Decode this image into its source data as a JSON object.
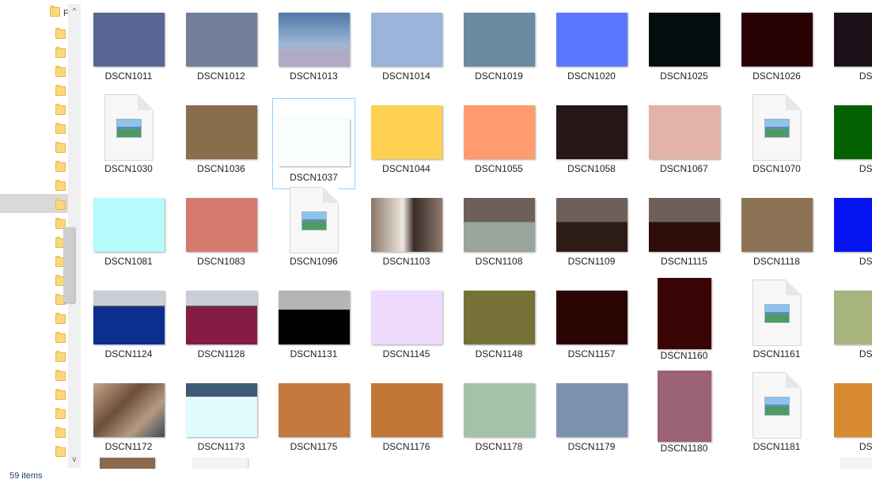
{
  "status": {
    "item_count": "59 items"
  },
  "nav": {
    "top_letter": "F"
  },
  "scrollbar": {
    "up_arrow": "^",
    "down_arrow": "v"
  },
  "tiles": [
    {
      "name": "DSCN1011",
      "color": "#5a6796"
    },
    {
      "name": "DSCN1012",
      "color": "#717f9d"
    },
    {
      "name": "DSCN1013",
      "color": "#b3a9c4",
      "photo": "sky"
    },
    {
      "name": "DSCN1014",
      "color": "#9cb3da"
    },
    {
      "name": "DSCN1019",
      "color": "#698aa1"
    },
    {
      "name": "DSCN1020",
      "color": "#5a78ff"
    },
    {
      "name": "DSCN1025",
      "color": "#020d10"
    },
    {
      "name": "DSCN1026",
      "color": "#290304"
    },
    {
      "name": "DSC",
      "color": "#1d1119",
      "partial": true
    },
    {
      "name": "DSCN1030",
      "icon": true
    },
    {
      "name": "DSCN1036",
      "color": "#8a6d4d"
    },
    {
      "name": "DSCN1037",
      "color": "#f8fdfd",
      "selected": true
    },
    {
      "name": "DSCN1044",
      "color": "#ffd152"
    },
    {
      "name": "DSCN1055",
      "color": "#ff9b6d"
    },
    {
      "name": "DSCN1058",
      "color": "#251716"
    },
    {
      "name": "DSCN1067",
      "color": "#e1b4a7"
    },
    {
      "name": "DSCN1070",
      "icon": true
    },
    {
      "name": "DSC",
      "color": "#036101",
      "partial": true
    },
    {
      "name": "DSCN1081",
      "color": "#b6fcfd"
    },
    {
      "name": "DSCN1083",
      "color": "#d77a6e"
    },
    {
      "name": "DSCN1096",
      "icon": true
    },
    {
      "name": "DSCN1103",
      "color": "#7a665c",
      "photo": "people"
    },
    {
      "name": "DSCN1108",
      "color": "#99a49a",
      "photo": "desk"
    },
    {
      "name": "DSCN1109",
      "color": "#2d1c15",
      "photo": "desk"
    },
    {
      "name": "DSCN1115",
      "color": "#2e0c07",
      "photo": "desk"
    },
    {
      "name": "DSCN1118",
      "color": "#8d7356"
    },
    {
      "name": "DSC",
      "color": "#0514f0",
      "partial": true
    },
    {
      "name": "DSCN1124",
      "color": "#0c2e8f",
      "photo": "trees"
    },
    {
      "name": "DSCN1128",
      "color": "#851c45",
      "photo": "trees"
    },
    {
      "name": "DSCN1131",
      "color": "#000000",
      "photo": "gray"
    },
    {
      "name": "DSCN1145",
      "color": "#eedbfe"
    },
    {
      "name": "DSCN1148",
      "color": "#767137"
    },
    {
      "name": "DSCN1157",
      "color": "#2b0404"
    },
    {
      "name": "DSCN1160",
      "color": "#3a0404",
      "portrait": true
    },
    {
      "name": "DSCN1161",
      "icon": true
    },
    {
      "name": "DSC",
      "color": "#a8b47e",
      "partial": true
    },
    {
      "name": "DSCN1172",
      "color": "#8b6b52",
      "photo": "mural"
    },
    {
      "name": "DSCN1173",
      "color": "#e2fcfd",
      "photo": "blue"
    },
    {
      "name": "DSCN1175",
      "color": "#c3783d"
    },
    {
      "name": "DSCN1176",
      "color": "#c27738"
    },
    {
      "name": "DSCN1178",
      "color": "#a5c1a8"
    },
    {
      "name": "DSCN1179",
      "color": "#7c93b0"
    },
    {
      "name": "DSCN1180",
      "color": "#9b6176",
      "portrait": true
    },
    {
      "name": "DSCN1181",
      "icon": true
    },
    {
      "name": "DSC",
      "color": "#d78a2f",
      "partial": true
    }
  ]
}
